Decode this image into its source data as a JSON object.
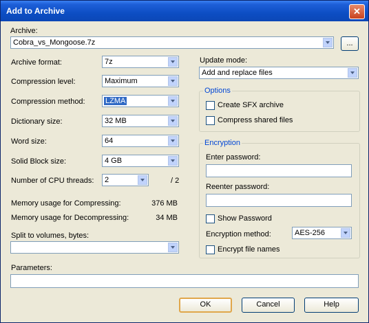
{
  "window": {
    "title": "Add to Archive"
  },
  "archive": {
    "label": "Archive:",
    "value": "Cobra_vs_Mongoose.7z",
    "browse_label": "..."
  },
  "format": {
    "label": "Archive format:",
    "value": "7z"
  },
  "compression_level": {
    "label": "Compression level:",
    "value": "Maximum"
  },
  "compression_method": {
    "label": "Compression method:",
    "value": "LZMA"
  },
  "dictionary_size": {
    "label": "Dictionary size:",
    "value": "32 MB"
  },
  "word_size": {
    "label": "Word size:",
    "value": "64"
  },
  "solid_block_size": {
    "label": "Solid Block size:",
    "value": "4 GB"
  },
  "cpu_threads": {
    "label": "Number of CPU threads:",
    "value": "2",
    "max": "/ 2"
  },
  "memory": {
    "compress_label": "Memory usage for Compressing:",
    "compress_value": "376 MB",
    "decompress_label": "Memory usage for Decompressing:",
    "decompress_value": "34 MB"
  },
  "split": {
    "label": "Split to volumes, bytes:",
    "value": ""
  },
  "parameters": {
    "label": "Parameters:",
    "value": ""
  },
  "update_mode": {
    "label": "Update mode:",
    "value": "Add and replace files"
  },
  "options": {
    "legend": "Options",
    "sfx_label": "Create SFX archive",
    "shared_label": "Compress shared files"
  },
  "encryption": {
    "legend": "Encryption",
    "enter_password_label": "Enter password:",
    "reenter_password_label": "Reenter password:",
    "show_password_label": "Show Password",
    "method_label": "Encryption method:",
    "method_value": "AES-256",
    "encrypt_names_label": "Encrypt file names"
  },
  "buttons": {
    "ok": "OK",
    "cancel": "Cancel",
    "help": "Help"
  }
}
